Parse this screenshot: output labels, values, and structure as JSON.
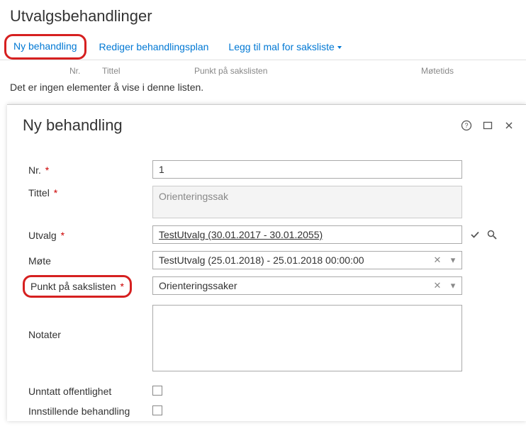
{
  "page": {
    "title": "Utvalgsbehandlinger"
  },
  "tabs": {
    "ny": "Ny behandling",
    "rediger": "Rediger behandlingsplan",
    "mal": "Legg til mal for saksliste"
  },
  "list_header": {
    "nr": "Nr.",
    "tittel": "Tittel",
    "punkt": "Punkt på sakslisten",
    "motetids": "Møtetids"
  },
  "empty": "Det er ingen elementer å vise i denne listen.",
  "modal": {
    "title": "Ny behandling",
    "labels": {
      "nr": "Nr.",
      "tittel": "Tittel",
      "utvalg": "Utvalg",
      "mote": "Møte",
      "punkt": "Punkt på sakslisten",
      "notater": "Notater",
      "unntatt": "Unntatt offentlighet",
      "innstillende": "Innstillende behandling"
    },
    "values": {
      "nr": "1",
      "tittel_placeholder": "Orienteringssak",
      "utvalg": "TestUtvalg (30.01.2017 - 30.01.2055)",
      "mote": "TestUtvalg (25.01.2018) - 25.01.2018 00:00:00",
      "punkt": "Orienteringssaker",
      "notater": ""
    }
  }
}
